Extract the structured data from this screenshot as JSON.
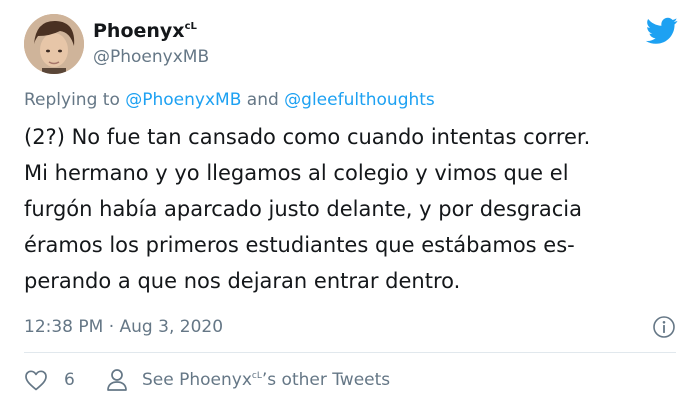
{
  "author": {
    "display_name": "Phoenyx",
    "display_name_sup": "cL",
    "handle": "@PhoenyxMB"
  },
  "reply": {
    "prefix": "Replying to ",
    "mention_1": "@PhoenyxMB",
    "connector": " and ",
    "mention_2": "@gleefulthoughts"
  },
  "tweet": {
    "lines": [
      "(2?) No fue tan cansado como cuando intentas correr.",
      "Mi hermano y yo llegamos al colegio y vimos que el",
      "furgón había aparcado justo delante, y por desgracia",
      "éramos los primeros estudiantes que estábamos es-",
      "perando a que nos dejaran entrar dentro."
    ],
    "timestamp": "12:38 PM · Aug 3, 2020"
  },
  "actions": {
    "like_count": "6",
    "other_tweets_prefix": "See Phoenyx",
    "other_tweets_sup": "cL",
    "other_tweets_suffix": "’s other Tweets"
  },
  "icons": {
    "brand": "twitter-bird-icon",
    "info": "info-icon",
    "like": "heart-icon",
    "profile": "person-icon"
  },
  "colors": {
    "brand": "#1da1f2",
    "text": "#14171a",
    "muted": "#657786",
    "divider": "#e1e8ed"
  }
}
